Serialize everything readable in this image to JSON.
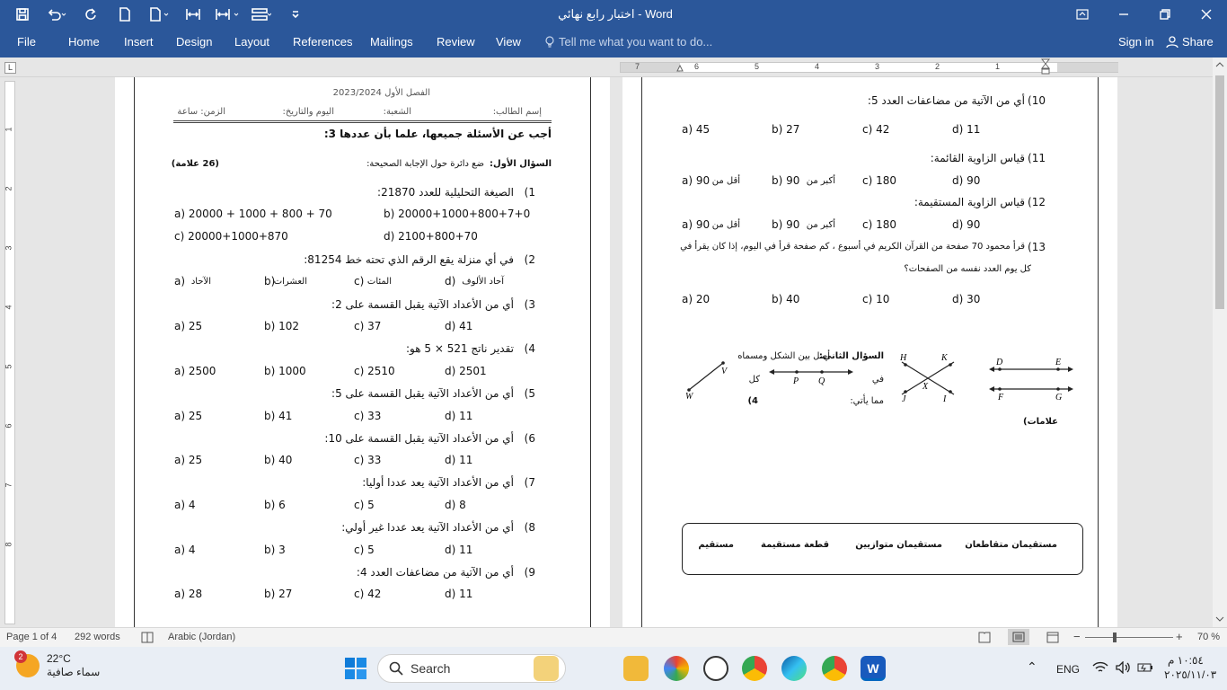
{
  "window": {
    "title": "اختبار رابع نهائي - Word",
    "controls": [
      "ribbon-display-options",
      "minimize",
      "restore",
      "close"
    ]
  },
  "ribbon": {
    "tabs": [
      "File",
      "Home",
      "Insert",
      "Design",
      "Layout",
      "References",
      "Mailings",
      "Review",
      "View"
    ],
    "tell_me": "Tell me what you want to do...",
    "sign_in": "Sign in",
    "share": "Share"
  },
  "ruler": {
    "tab_selector": "L",
    "h_numbers": [
      "7",
      "6",
      "5",
      "4",
      "3",
      "2",
      "1"
    ],
    "v_numbers": [
      "1",
      "2",
      "3",
      "4",
      "5",
      "6",
      "7",
      "8"
    ]
  },
  "page1": {
    "header_line1": "الفصل الأول 2023/2024",
    "header_student": "إسم الطالب:",
    "header_section": "الشعبة:",
    "header_date": "اليوم والتاريخ:",
    "header_time": "الزمن: ساعة",
    "instruction": "أجب عن الأسئلة جميعها، علما بأن عددها 3:",
    "q1_title": "السؤال الأول:",
    "q1_text": "ضع دائرة حول الإجابة الصحيحة:",
    "q1_marks": "(26 علامة)",
    "questions": [
      {
        "num": "1)",
        "text": "الصيغة التحليلية للعدد 21870:",
        "options": [
          "a)  20000 + 1000 + 800 + 70",
          "b) 20000+1000+800+7+0",
          "c) 20000+1000+870",
          "d) 2100+800+70"
        ]
      },
      {
        "num": "2)",
        "text": "في أي منزلة يقع الرقم الذي تحته خط 81254:",
        "options": [
          "a)",
          "الآحاد",
          "b)",
          "العشرات",
          "c)",
          "المئات",
          "d)",
          "آحاد الألوف"
        ]
      },
      {
        "num": "3)",
        "text": "أي من الأعداد الآتية يقبل القسمة على 2:",
        "options": [
          "a)  25",
          "b) 102",
          "c) 37",
          "d) 41"
        ]
      },
      {
        "num": "4)",
        "text": "تقدير ناتج 521 × 5 هو:",
        "options": [
          "a)  2500",
          "b) 1000",
          "c) 2510",
          "d) 2501"
        ]
      },
      {
        "num": "5)",
        "text": "أي من الأعداد الآتية يقبل القسمة على 5:",
        "options": [
          "a)  25",
          "b) 41",
          "c) 33",
          "d) 11"
        ]
      },
      {
        "num": "6)",
        "text": "أي من الأعداد الآتية يقبل القسمة على 10:",
        "options": [
          "a)  25",
          "b) 40",
          "c) 33",
          "d) 11"
        ]
      },
      {
        "num": "7)",
        "text": "أي من الأعداد الآتية يعد عددا أوليا:",
        "options": [
          "a)  4",
          "b) 6",
          "c) 5",
          "d) 8"
        ]
      },
      {
        "num": "8)",
        "text": "أي من الأعداد الآتية يعد عددا غير أولي:",
        "options": [
          "a)  4",
          "b) 3",
          "c) 5",
          "d) 11"
        ]
      },
      {
        "num": "9)",
        "text": "أي من الآتية من مضاعفات العدد 4:",
        "options": [
          "a)  28",
          "b) 27",
          "c) 42",
          "d) 11"
        ]
      }
    ]
  },
  "page2": {
    "questions": [
      {
        "num": "10)",
        "text": "أي من الآتية من مضاعفات العدد 5:",
        "options": [
          "a) 45",
          "b) 27",
          "c) 42",
          "d) 11"
        ]
      },
      {
        "num": "11)",
        "text": "قياس الزاوية القائمة:",
        "options": [
          "a)  90",
          "أقل من",
          "b)  90",
          "أكبر من",
          "c) 180",
          "d) 90"
        ]
      },
      {
        "num": "12)",
        "text": "قياس الزاوية المستقيمة:",
        "options": [
          "a)  90",
          "أقل من",
          "b)  90",
          "أكبر من",
          "c) 180",
          "d) 90"
        ]
      },
      {
        "num": "13)",
        "text": "قرأ محمود 70 صفحة من القرآن الكريم في أسبوع ، كم صفحة قرأ في اليوم، إذا كان يقرأ في",
        "text2": "كل يوم العدد نفسه من الصفحات؟",
        "options": [
          "a) 20",
          "b) 40",
          "c) 10",
          "d) 30"
        ]
      }
    ],
    "q2_title": "السؤال الثاني:",
    "q2_text": "أصل بين الشكل ومسماه",
    "q2_line2": "في",
    "q2_line2b": "كل",
    "q2_line3": "مما يأتي:",
    "q2_marks": "4)",
    "q2_marks2": "علامات)",
    "figure_labels": {
      "D": "D",
      "E": "E",
      "F": "F",
      "G": "G",
      "H": "H",
      "K": "K",
      "J": "J",
      "I": "I",
      "X": "X",
      "P": "P",
      "Q": "Q",
      "V": "V",
      "W": "W"
    },
    "names": [
      "مستقيمان متقاطعان",
      "مستقيمان متوازيين",
      "قطعة مستقيمة",
      "مستقيم"
    ]
  },
  "status": {
    "page": "Page 1 of 4",
    "words": "292 words",
    "language": "Arabic (Jordan)",
    "zoom": "70 %",
    "zoom_level": 0.7
  },
  "taskbar": {
    "temp": "22°C",
    "weather": "سماء صافية",
    "weather_badge": "2",
    "search": "Search",
    "lang": "ENG",
    "time": "١٠:٥٤ م",
    "date": "٢٠٢٥/١١/٠٣"
  },
  "colors": {
    "accent": "#2b579a"
  }
}
